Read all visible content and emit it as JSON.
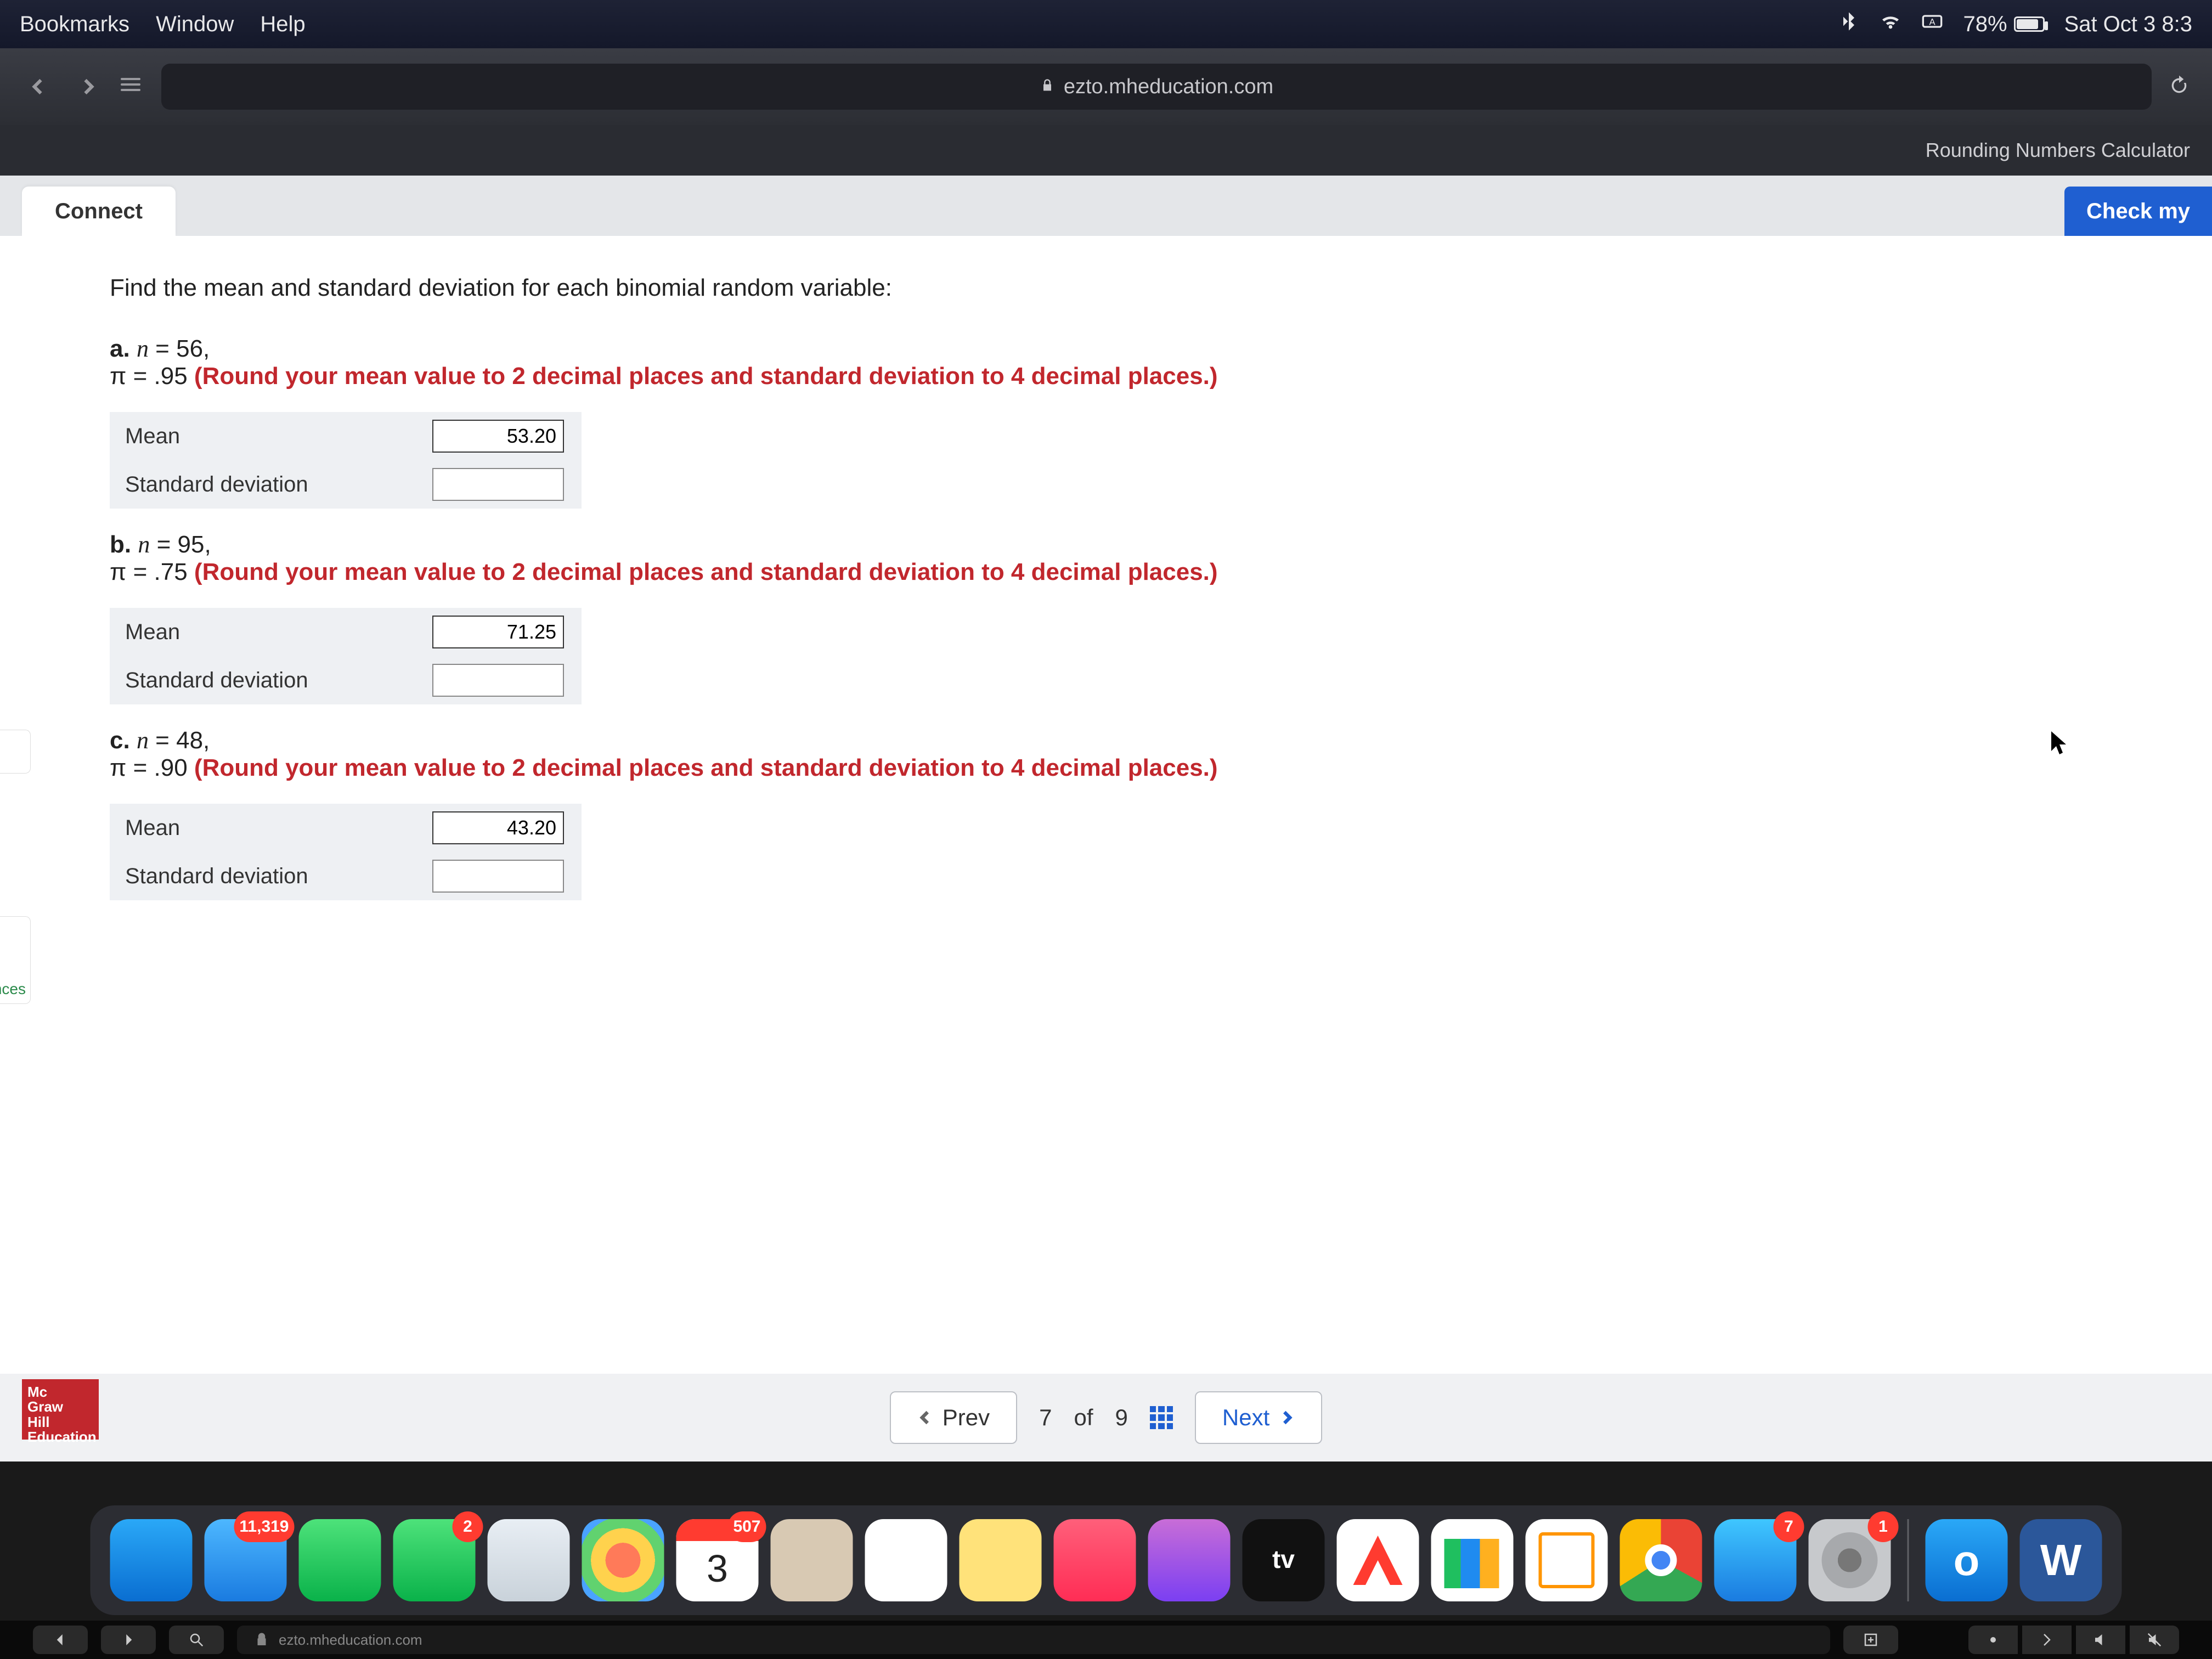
{
  "menubar": {
    "items": [
      "Bookmarks",
      "Window",
      "Help"
    ],
    "battery": "78%",
    "datetime": "Sat Oct 3  8:3"
  },
  "safari": {
    "url": "ezto.mheducation.com",
    "bookmark": "Rounding Numbers Calculator"
  },
  "page": {
    "tab": "Connect",
    "check_btn": "Check my",
    "prompt": "Find the mean and standard deviation for each binomial random variable:",
    "instr_text": "(Round your mean value to 2 decimal places and standard deviation to 4 decimal places.)",
    "labels": {
      "mean": "Mean",
      "sd": "Standard deviation"
    },
    "parts": [
      {
        "letter": "a.",
        "n_label": "n",
        "n": "56",
        "pi_label": "π",
        "pi": ".95",
        "mean": "53.20",
        "sd": ""
      },
      {
        "letter": "b.",
        "n_label": "n",
        "n": "95",
        "pi_label": "π",
        "pi": ".75",
        "mean": "71.25",
        "sd": ""
      },
      {
        "letter": "c.",
        "n_label": "n",
        "n": "48",
        "pi_label": "π",
        "pi": ".90",
        "mean": "43.20",
        "sd": ""
      }
    ],
    "stub_text": "nces",
    "pager": {
      "prev": "Prev",
      "page": "7",
      "of": "of",
      "total": "9",
      "next": "Next"
    },
    "brand": "Mc\nGraw\nHill\nEducation"
  },
  "dock": {
    "cal_day": "3",
    "mail_badge": "11,319",
    "messages_badge": "2",
    "cal_badge": "507",
    "appstore_badge": "7",
    "sysprefs_badge": "1",
    "tv_label": "tv",
    "outlook_letter": "o",
    "word_letter": "W"
  },
  "touchbar": {
    "url_hint": "ezto.mheducation.com"
  }
}
